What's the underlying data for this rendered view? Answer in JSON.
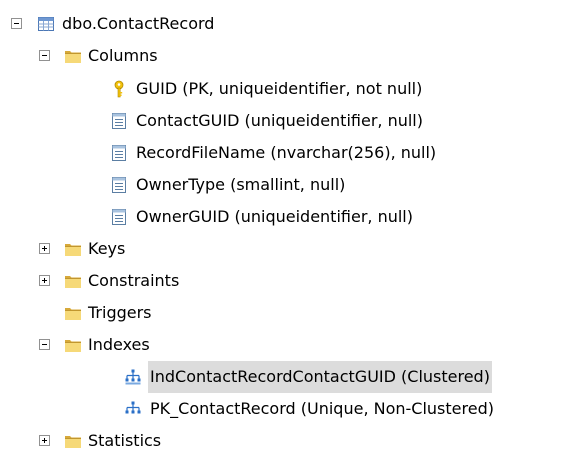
{
  "tree": {
    "root": {
      "label": "dbo.ContactRecord",
      "expanded": true,
      "icon": "table-icon"
    },
    "columns_folder": {
      "label": "Columns",
      "expanded": true,
      "icon": "folder-icon",
      "items": [
        {
          "label": "GUID (PK, uniqueidentifier, not null)",
          "icon": "key-icon"
        },
        {
          "label": "ContactGUID (uniqueidentifier, null)",
          "icon": "column-icon"
        },
        {
          "label": "RecordFileName (nvarchar(256), null)",
          "icon": "column-icon"
        },
        {
          "label": "OwnerType (smallint, null)",
          "icon": "column-icon"
        },
        {
          "label": "OwnerGUID (uniqueidentifier, null)",
          "icon": "column-icon"
        }
      ]
    },
    "keys_folder": {
      "label": "Keys",
      "expanded": false,
      "icon": "folder-icon"
    },
    "constraints_folder": {
      "label": "Constraints",
      "expanded": false,
      "icon": "folder-icon"
    },
    "triggers_folder": {
      "label": "Triggers",
      "icon": "folder-icon"
    },
    "indexes_folder": {
      "label": "Indexes",
      "expanded": true,
      "icon": "folder-icon",
      "items": [
        {
          "label": "IndContactRecordContactGUID (Clustered)",
          "icon": "clustered-index-icon",
          "selected": true
        },
        {
          "label": "PK_ContactRecord (Unique, Non-Clustered)",
          "icon": "nonclustered-index-icon",
          "selected": false
        }
      ]
    },
    "statistics_folder": {
      "label": "Statistics",
      "expanded": false,
      "icon": "folder-icon"
    }
  },
  "colors": {
    "folder": "#f6d978",
    "folder_dark": "#d7a93a",
    "selection": "#dcdcdc",
    "key": "#f2c20c",
    "index": "#2a6fc7",
    "column_border": "#5b7ea3"
  }
}
